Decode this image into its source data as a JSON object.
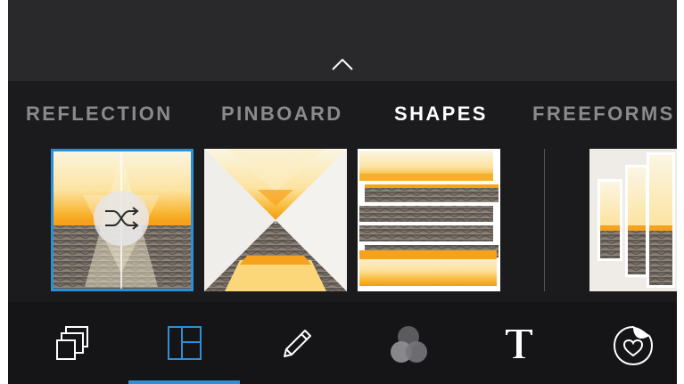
{
  "header": {
    "collapse_icon": "chevron-up-icon"
  },
  "tabs": [
    {
      "label": "REFLECTION",
      "active": false
    },
    {
      "label": "PINBOARD",
      "active": false
    },
    {
      "label": "SHAPES",
      "active": true
    },
    {
      "label": "FREEFORMS",
      "active": false
    }
  ],
  "layouts": [
    {
      "kind": "triangles",
      "selected": true,
      "overlay_icon": "shuffle-icon"
    },
    {
      "kind": "hourglass",
      "selected": false
    },
    {
      "kind": "stripes",
      "selected": false
    },
    {
      "kind": "columns",
      "selected": false
    }
  ],
  "toolbar": [
    {
      "icon": "layers-icon",
      "active": false
    },
    {
      "icon": "layout-icon",
      "active": true
    },
    {
      "icon": "pencil-icon",
      "active": false
    },
    {
      "icon": "color-circles-icon",
      "active": false
    },
    {
      "icon": "text-icon",
      "active": false
    },
    {
      "icon": "sticker-icon",
      "active": false
    }
  ],
  "colors": {
    "accent": "#2d8fd5",
    "background": "#1b1b1d",
    "tab_active": "#ffffff",
    "tab_inactive": "#8a8a8d"
  }
}
